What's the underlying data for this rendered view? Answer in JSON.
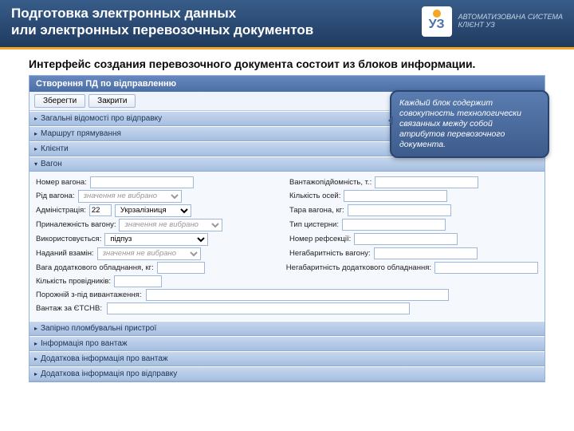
{
  "header": {
    "title_line1": "Подготовка электронных данных",
    "title_line2": "или  электронных перевозочных документов",
    "logo_glyph": "УЗ",
    "logo_text1": "АВТОМАТИЗОВАНА СИСТЕМА",
    "logo_text2": "КЛІЄНТ УЗ"
  },
  "subtitle": "Интерфейс создания перевозочного документа состоит из блоков информации.",
  "window_title": "Створення ПД по відправленню",
  "toolbar": {
    "save": "Зберегти",
    "close": "Закрити"
  },
  "sections": {
    "s1": "Загальні відомості про відправку",
    "s2": "Маршрут прямування",
    "s3": "Клієнти",
    "s4": "Вагон",
    "s5": "Запірно пломбувальні пристрої",
    "s6": "Інформація про вантаж",
    "s7": "Додаткова інформація про вантаж",
    "s8": "Додаткова інформація про відправку"
  },
  "form": {
    "wagon_no": "Номер вагона:",
    "capacity": "Вантажопідйомність, т.:",
    "wagon_type": "Рід вагона:",
    "axles": "Кількість осей:",
    "admin": "Адміністрація:",
    "tare": "Тара вагона, кг:",
    "ownership": "Приналежність вагону:",
    "tank_type": "Тип цистерни:",
    "used_as": "Використовується:",
    "refsection": "Номер рефсекції:",
    "given_instead": "Наданий взамін:",
    "oversize": "Негабаритність вагону:",
    "addl_equip_weight": "Вага додаткового обладнання, кг:",
    "addl_equip_oversize": "Негабаритність додаткового обладнання:",
    "guides_count": "Кількість провідників:",
    "empty_after": "Порожній з-під вивантаження:",
    "cargo_etsnv": "Вантаж за ЄТСНВ:",
    "admin_code": "22",
    "admin_name": "Укрзалізниця",
    "not_selected": "значення не вибрано",
    "used_as_val": "підпуз"
  },
  "callout": "Каждый блок содержит совокупность технологически связанных между собой атрибутов перевозочного документа."
}
